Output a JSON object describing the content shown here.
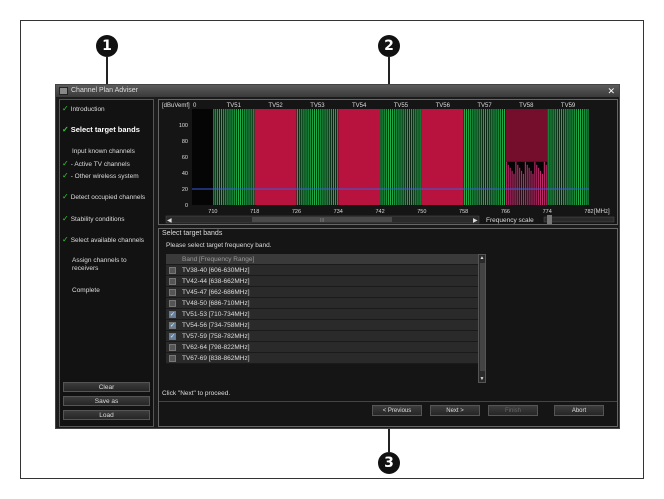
{
  "callouts": {
    "one": "1",
    "two": "2",
    "three": "3"
  },
  "window": {
    "title": "Channel Plan Adviser",
    "close": "✕"
  },
  "sidebar": {
    "steps": [
      {
        "label": "Introduction",
        "checked": true
      },
      {
        "label": "Select target bands",
        "checked": true,
        "active": true
      },
      {
        "label": "Input known channels",
        "checked": false
      },
      {
        "label": "- Active TV channels",
        "checked": true
      },
      {
        "label": "- Other wireless system",
        "checked": true
      },
      {
        "label": "Detect occupied channels",
        "checked": true
      },
      {
        "label": "Stability conditions",
        "checked": true
      },
      {
        "label": "Select available channels",
        "checked": true
      },
      {
        "label": "Assign channels to receivers",
        "checked": false
      },
      {
        "label": "Complete",
        "checked": false
      }
    ],
    "buttons": {
      "clear": "Clear",
      "save_as": "Save as",
      "load": "Load"
    }
  },
  "chart_data": {
    "type": "area",
    "ylabel": "[dBuVemf]",
    "xlabel": "[MHz]",
    "y_ticks": [
      "100",
      "80",
      "60",
      "40",
      "20",
      "0"
    ],
    "y_top_label": "0",
    "x_ticks": [
      "710",
      "718",
      "726",
      "734",
      "742",
      "750",
      "758",
      "766",
      "774",
      "782"
    ],
    "channels": [
      "TV51",
      "TV52",
      "TV53",
      "TV54",
      "TV55",
      "TV56",
      "TV57",
      "TV58",
      "TV59"
    ],
    "channel_state": [
      "available",
      "occupied",
      "available",
      "occupied",
      "available",
      "occupied",
      "available",
      "partial",
      "available"
    ],
    "xlim": [
      706,
      782
    ],
    "ylim": [
      0,
      120
    ],
    "threshold_level": 20
  },
  "chart_footer": {
    "scroll_marker": "III",
    "frequency_scale": "Frequency scale"
  },
  "lower": {
    "title": "Select target bands",
    "instruction": "Please select target frequency band.",
    "column_header": "Band [Frequency Range]",
    "bands": [
      {
        "label": "TV38-40 [606-630MHz]",
        "checked": false
      },
      {
        "label": "TV42-44 [638-662MHz]",
        "checked": false
      },
      {
        "label": "TV45-47 [662-686MHz]",
        "checked": false
      },
      {
        "label": "TV48-50 [686-710MHz]",
        "checked": false
      },
      {
        "label": "TV51-53 [710-734MHz]",
        "checked": true
      },
      {
        "label": "TV54-56 [734-758MHz]",
        "checked": true
      },
      {
        "label": "TV57-59 [758-782MHz]",
        "checked": true
      },
      {
        "label": "TV62-64 [798-822MHz]",
        "checked": false
      },
      {
        "label": "TV67-69 [838-862MHz]",
        "checked": false
      }
    ],
    "status": "Click \"Next\" to proceed.",
    "nav": {
      "previous": "< Previous",
      "next": "Next >",
      "finish": "Finish",
      "abort": "Abort"
    }
  },
  "colors": {
    "available": "#1fae4a",
    "occupied": "#b8133f",
    "partial": "#8a0f34",
    "accent_check": "#2fd12f"
  }
}
